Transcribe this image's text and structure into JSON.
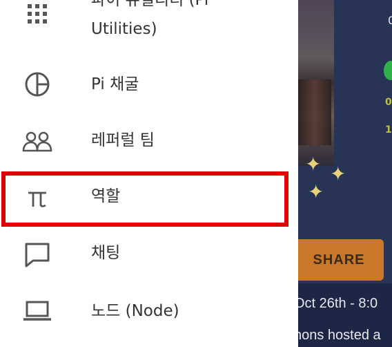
{
  "menu": {
    "items": [
      {
        "key": "pi-utilities",
        "label_line1": "파이 유틸리티 (Pi",
        "label_line2": "Utilities)",
        "icon": "grid-icon"
      },
      {
        "key": "pi-mining",
        "label": "Pi 채굴",
        "icon": "pie-chart-icon"
      },
      {
        "key": "referral-team",
        "label": "레퍼럴 팀",
        "icon": "people-icon"
      },
      {
        "key": "roles",
        "label": "역할",
        "icon": "pi-icon"
      },
      {
        "key": "chat",
        "label": "채팅",
        "icon": "chat-bubble-icon"
      },
      {
        "key": "node",
        "label": "노드 (Node)",
        "icon": "laptop-icon"
      }
    ]
  },
  "background": {
    "share_label": "SHARE",
    "date_text": "Oct 26th - 8:0",
    "hosted_text": "hons hosted a",
    "edge_text_top": "0",
    "edge_text_mid1": "0",
    "edge_text_mid2": "1"
  },
  "colors": {
    "highlight": "#e30000",
    "share_button": "#c97728",
    "background": "#283456"
  }
}
